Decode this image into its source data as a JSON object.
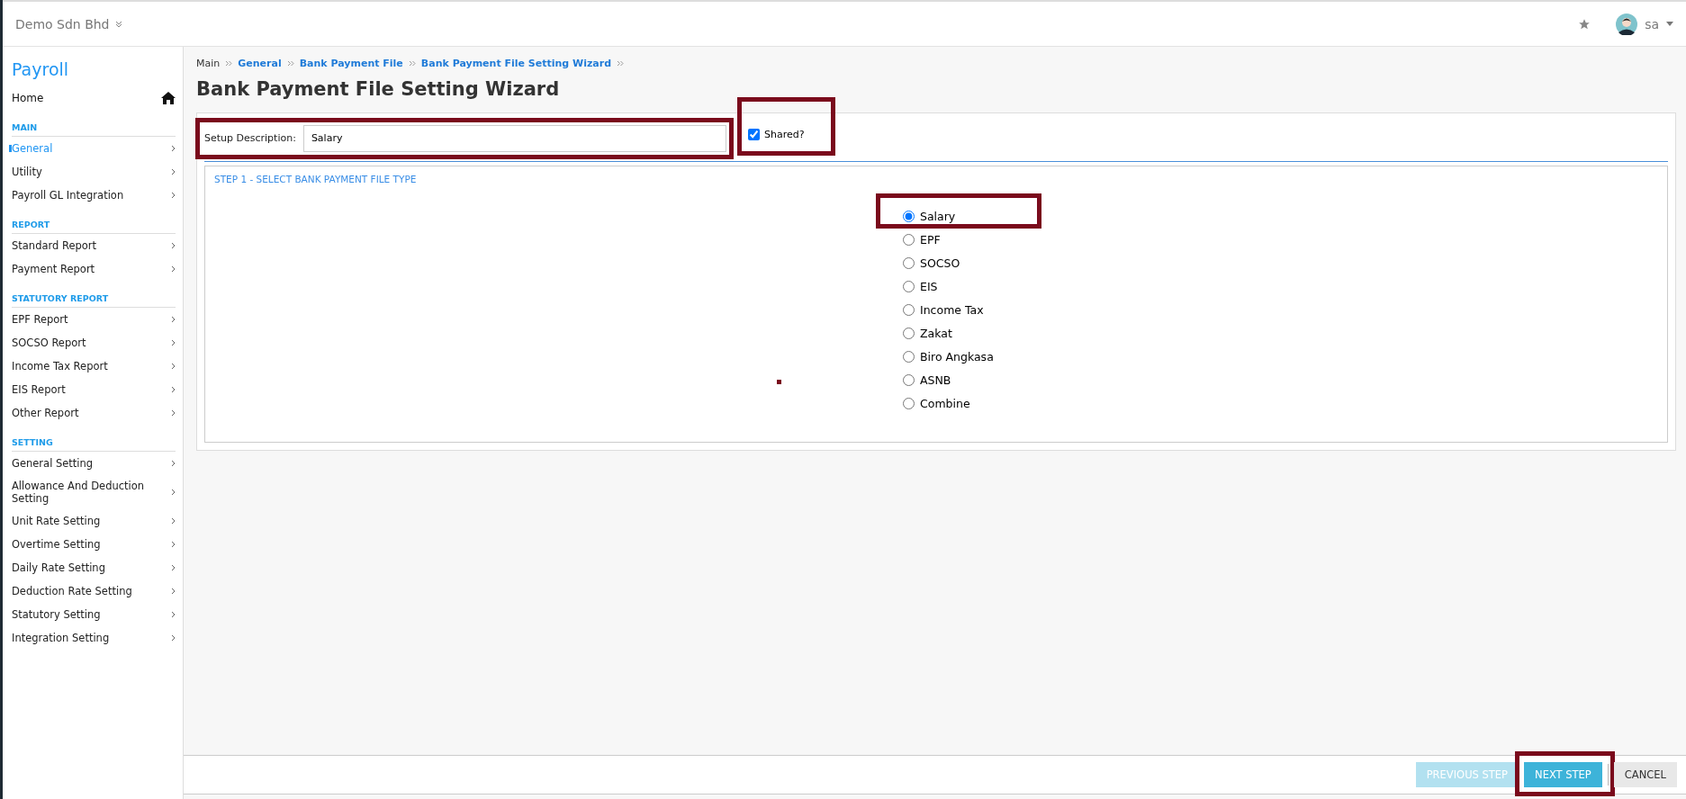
{
  "topbar": {
    "company": "Demo Sdn Bhd",
    "user": "sa"
  },
  "sidebar": {
    "title": "Payroll",
    "home": "Home",
    "sections": [
      {
        "heading": "MAIN",
        "items": [
          {
            "label": "General",
            "selected": true
          },
          {
            "label": "Utility",
            "selected": false
          },
          {
            "label": "Payroll GL Integration",
            "selected": false
          }
        ]
      },
      {
        "heading": "REPORT",
        "items": [
          {
            "label": "Standard Report",
            "selected": false
          },
          {
            "label": "Payment Report",
            "selected": false
          }
        ]
      },
      {
        "heading": "STATUTORY REPORT",
        "items": [
          {
            "label": "EPF Report",
            "selected": false
          },
          {
            "label": "SOCSO Report",
            "selected": false
          },
          {
            "label": "Income Tax Report",
            "selected": false
          },
          {
            "label": "EIS Report",
            "selected": false
          },
          {
            "label": "Other Report",
            "selected": false
          }
        ]
      },
      {
        "heading": "SETTING",
        "items": [
          {
            "label": "General Setting",
            "selected": false
          },
          {
            "label": "Allowance And Deduction Setting",
            "selected": false
          },
          {
            "label": "Unit Rate Setting",
            "selected": false
          },
          {
            "label": "Overtime Setting",
            "selected": false
          },
          {
            "label": "Daily Rate Setting",
            "selected": false
          },
          {
            "label": "Deduction Rate Setting",
            "selected": false
          },
          {
            "label": "Statutory Setting",
            "selected": false
          },
          {
            "label": "Integration Setting",
            "selected": false
          }
        ]
      }
    ]
  },
  "breadcrumb": [
    {
      "label": "Main",
      "kind": "text"
    },
    {
      "label": "General",
      "kind": "link"
    },
    {
      "label": "Bank Payment File",
      "kind": "link"
    },
    {
      "label": "Bank Payment File Setting Wizard",
      "kind": "link"
    }
  ],
  "page_title": "Bank Payment File Setting Wizard",
  "setup": {
    "label": "Setup Description:",
    "value": "Salary",
    "highlighted": true
  },
  "shared": {
    "label": "Shared?",
    "checked": true,
    "highlighted": true
  },
  "step": {
    "title": "STEP 1 - SELECT BANK PAYMENT FILE TYPE",
    "options": [
      {
        "label": "Salary",
        "selected": true,
        "highlighted": true
      },
      {
        "label": "EPF",
        "selected": false,
        "highlighted": false
      },
      {
        "label": "SOCSO",
        "selected": false,
        "highlighted": false
      },
      {
        "label": "EIS",
        "selected": false,
        "highlighted": false
      },
      {
        "label": "Income Tax",
        "selected": false,
        "highlighted": false
      },
      {
        "label": "Zakat",
        "selected": false,
        "highlighted": false
      },
      {
        "label": "Biro Angkasa",
        "selected": false,
        "highlighted": false
      },
      {
        "label": "ASNB",
        "selected": false,
        "highlighted": false
      },
      {
        "label": "Combine",
        "selected": false,
        "highlighted": false
      }
    ]
  },
  "footer": {
    "buttons": [
      {
        "label": "PREVIOUS STEP",
        "kind": "primary",
        "disabled": true,
        "highlighted": false
      },
      {
        "label": "NEXT STEP",
        "kind": "primary",
        "disabled": false,
        "highlighted": true
      },
      {
        "label": "CANCEL",
        "kind": "default",
        "disabled": false,
        "highlighted": false
      }
    ]
  }
}
